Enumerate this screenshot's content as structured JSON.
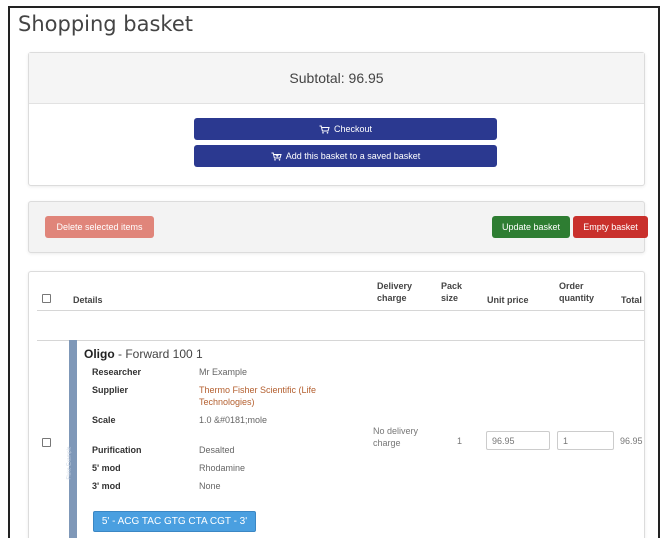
{
  "page": {
    "title": "Shopping basket"
  },
  "summary": {
    "subtotal": "Subtotal: 96.95",
    "checkout_label": "Checkout",
    "add_saved_label": "Add this basket to a saved basket"
  },
  "actions": {
    "delete_label": "Delete selected items",
    "update_label": "Update basket",
    "empty_label": "Empty basket"
  },
  "table": {
    "headers": {
      "details": "Details",
      "delivery_1": "Delivery",
      "delivery_2": "charge",
      "pack_1": "Pack",
      "pack_2": "size",
      "unit_price": "Unit price",
      "order_1": "Order",
      "order_2": "quantity",
      "total": "Total"
    },
    "row": {
      "side_label": "Fluke Example",
      "type": "Oligo",
      "name": " - Forward 100 1",
      "fields": {
        "researcher_label": "Researcher",
        "researcher_value": "Mr Example",
        "supplier_label": "Supplier",
        "supplier_value_1": "Thermo Fisher Scientific (Life",
        "supplier_value_2": "Technologies)",
        "scale_label": "Scale",
        "scale_value": "1.0 &#0181;mole",
        "purification_label": "Purification",
        "purification_value": "Desalted",
        "mod5_label": "5' mod",
        "mod5_value": "Rhodamine",
        "mod3_label": "3' mod",
        "mod3_value": "None"
      },
      "sequence": "5' - ACG TAC GTG CTA CGT - 3'",
      "delivery_1": "No delivery",
      "delivery_2": "charge",
      "pack_size": "1",
      "unit_price": "96.95",
      "quantity": "1",
      "total": "96.95"
    }
  },
  "colors": {
    "primary": "#2b3990",
    "delete": "#e0857a",
    "update": "#2e7d32",
    "empty": "#c9302c",
    "sequence": "#4a9fe0",
    "link": "#b46030"
  }
}
